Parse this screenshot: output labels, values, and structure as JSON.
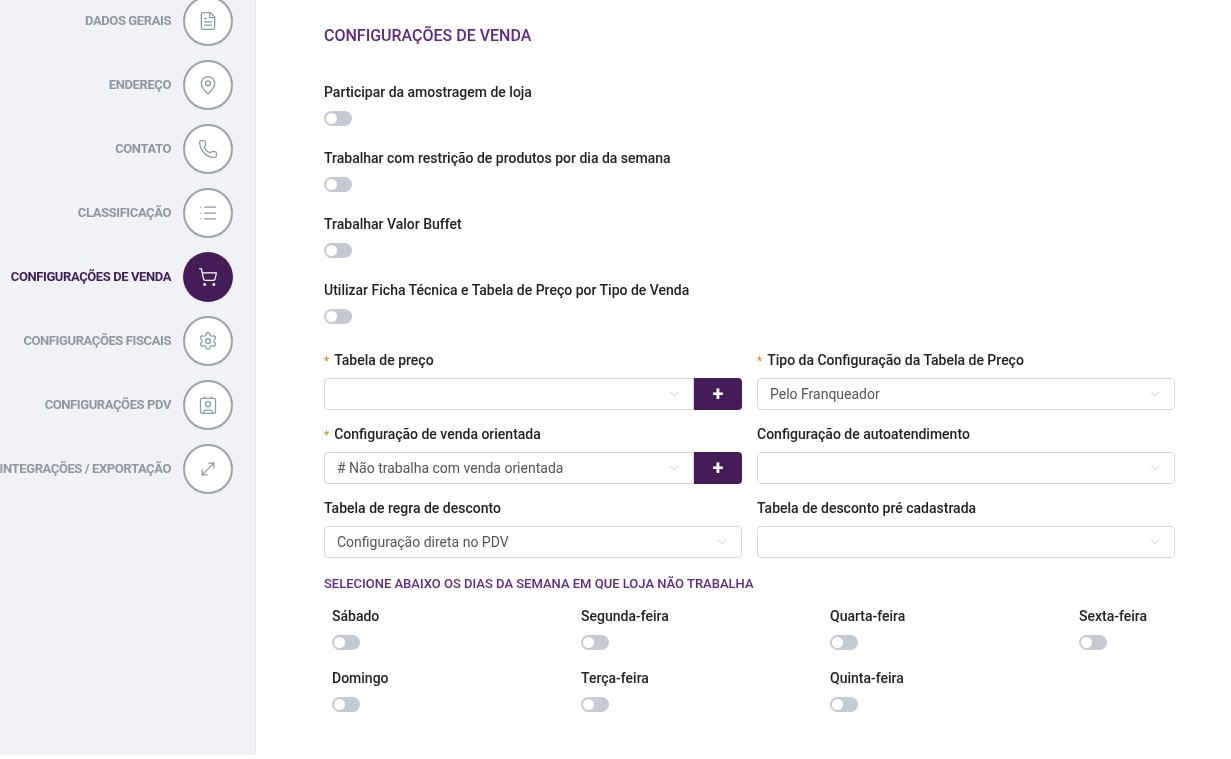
{
  "sidebar": {
    "items": [
      {
        "label": "DADOS GERAIS",
        "selected": false
      },
      {
        "label": "ENDEREÇO",
        "selected": false
      },
      {
        "label": "CONTATO",
        "selected": false
      },
      {
        "label": "CLASSIFICAÇÃO",
        "selected": false
      },
      {
        "label": "CONFIGURAÇÕES DE VENDA",
        "selected": true
      },
      {
        "label": "CONFIGURAÇÕES FISCAIS",
        "selected": false
      },
      {
        "label": "CONFIGURAÇÕES PDV",
        "selected": false
      },
      {
        "label": "INTEGRAÇÕES / EXPORTAÇÃO",
        "selected": false
      }
    ]
  },
  "title": "CONFIGURAÇÕES DE VENDA",
  "switches": [
    {
      "label": "Participar da amostragem de loja",
      "on": false
    },
    {
      "label": "Trabalhar com restrição de produtos por dia da semana",
      "on": false
    },
    {
      "label": "Trabalhar Valor Buffet",
      "on": false
    },
    {
      "label": "Utilizar Ficha Técnica e Tabela de Preço por Tipo de Venda",
      "on": false
    }
  ],
  "fields": [
    {
      "required_mark": "*",
      "label": "Tabela de preço",
      "add_button": "+"
    },
    {
      "required_mark": "*",
      "label": "Tipo da Configuração da Tabela de Preço",
      "value": "Pelo Franqueador"
    },
    {
      "required_mark": "*",
      "label": "Configuração de venda orientada",
      "value": "# Não trabalha com venda orientada",
      "add_button": "+"
    },
    {
      "label": "Configuração de autoatendimento"
    },
    {
      "label": "Tabela de regra de desconto",
      "value": "Configuração direta no PDV"
    },
    {
      "label": "Tabela de desconto pré cadastrada"
    }
  ],
  "days_title": "SELECIONE ABAIXO OS DIAS DA SEMANA EM QUE LOJA NÃO TRABALHA",
  "days": [
    {
      "label": "Sábado",
      "on": false
    },
    {
      "label": "Segunda-feira",
      "on": false
    },
    {
      "label": "Quarta-feira",
      "on": false
    },
    {
      "label": "Sexta-feira",
      "on": false
    },
    {
      "label": "Domingo",
      "on": false
    },
    {
      "label": "Terça-feira",
      "on": false
    },
    {
      "label": "Quinta-feira",
      "on": false
    }
  ]
}
